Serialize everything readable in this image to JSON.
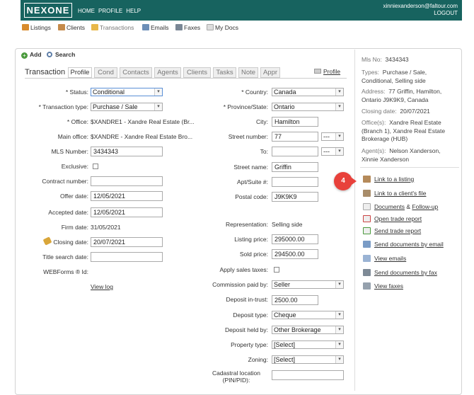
{
  "header": {
    "logo": "NEXONE",
    "nav": [
      "HOME",
      "PROFILE",
      "HELP"
    ],
    "email": "xinniexanderson@faltour.com",
    "logout": "LOGOUT"
  },
  "mainnav": [
    "Listings",
    "Clients",
    "Transactions",
    "Emails",
    "Faxes",
    "My Docs"
  ],
  "subbar": {
    "add": "Add",
    "search": "Search"
  },
  "tabs": {
    "title": "Transaction",
    "items": [
      "Profile",
      "Cond",
      "Contacts",
      "Agents",
      "Clients",
      "Tasks",
      "Note",
      "Appr"
    ],
    "profile_link": "Profile"
  },
  "left": {
    "status": {
      "label": "* Status:",
      "value": "Conditional"
    },
    "ttype": {
      "label": "* Transaction type:",
      "value": "Purchase / Sale"
    },
    "office": {
      "label": "* Office:",
      "value": "$XANDRE1 - Xandre Real Estate (Br..."
    },
    "mainoffice": {
      "label": "Main office:",
      "value": "$XANDRE - Xandre Real Estate Bro..."
    },
    "mls": {
      "label": "MLS Number:",
      "value": "3434343"
    },
    "exclusive": {
      "label": "Exclusive:"
    },
    "contract": {
      "label": "Contract number:",
      "value": ""
    },
    "offer": {
      "label": "Offer date:",
      "value": "12/05/2021"
    },
    "accepted": {
      "label": "Accepted date:",
      "value": "12/05/2021"
    },
    "firm": {
      "label": "Firm date:",
      "value": "31/05/2021"
    },
    "closing": {
      "label": "Closing date:",
      "value": "20/07/2021"
    },
    "title_search": {
      "label": "Title search date:",
      "value": ""
    },
    "webforms": {
      "label": "WEBForms ® Id:",
      "value": ""
    },
    "viewlog": "View log"
  },
  "right": {
    "country": {
      "label": "* Country:",
      "value": "Canada"
    },
    "province": {
      "label": "* Province/State:",
      "value": "Ontario"
    },
    "city": {
      "label": "City:",
      "value": "Hamilton"
    },
    "streetnum": {
      "label": "Street number:",
      "value": "77",
      "sel": "---"
    },
    "to": {
      "label": "To:",
      "value": "",
      "sel": "---"
    },
    "streetname": {
      "label": "Street name:",
      "value": "Griffin"
    },
    "apt": {
      "label": "Apt/Suite #:",
      "value": ""
    },
    "postal": {
      "label": "Postal code:",
      "value": "J9K9K9"
    },
    "representation": {
      "label": "Representation:",
      "value": "Selling side"
    },
    "listprice": {
      "label": "Listing price:",
      "value": "295000.00"
    },
    "soldprice": {
      "label": "Sold price:",
      "value": "294500.00"
    },
    "salestax": {
      "label": "Apply sales taxes:"
    },
    "commission": {
      "label": "Commission paid by:",
      "value": "Seller"
    },
    "deposit": {
      "label": "Deposit in-trust:",
      "value": "2500.00"
    },
    "deptype": {
      "label": "Deposit type:",
      "value": "Cheque"
    },
    "depheld": {
      "label": "Deposit held by:",
      "value": "Other Brokerage"
    },
    "proptype": {
      "label": "Property type:",
      "value": "[Select]"
    },
    "zoning": {
      "label": "Zoning:",
      "value": "[Select]"
    },
    "cadastral": {
      "label": "Cadastral location (PIN/PID):",
      "value": ""
    }
  },
  "summary": {
    "mls": {
      "label": "Mls No:",
      "value": "3434343"
    },
    "types": {
      "label": "Types:",
      "value1": "Purchase / Sale,",
      "value2": "Conditional, Selling side"
    },
    "address": {
      "label": "Address:",
      "value1": "77 Griffin, Hamilton,",
      "value2": "Ontario J9K9K9, Canada"
    },
    "closing": {
      "label": "Closing date:",
      "value": "20/07/2021"
    },
    "offices": {
      "label": "Office(s):",
      "value1": "Xandre Real Estate",
      "value2": "(Branch 1), Xandre Real Estate",
      "value3": "Brokerage (HUB)"
    },
    "agents": {
      "label": "Agent(s):",
      "value1": "Nelson Xanderson,",
      "value2": "Xinnie Xanderson"
    }
  },
  "actions": {
    "link_listing": "Link to a listing",
    "link_client": "Link to a client's file",
    "documents": "Documents",
    "amp": "&",
    "followup": "Follow-up",
    "open_trade": "Open trade report",
    "send_trade": "Send trade report",
    "send_email": "Send documents by email",
    "view_emails": "View emails",
    "send_fax": "Send documents by fax",
    "view_faxes": "View faxes"
  },
  "badge": "4",
  "colors": {
    "header": "#17635f",
    "badge": "#e8413b"
  }
}
